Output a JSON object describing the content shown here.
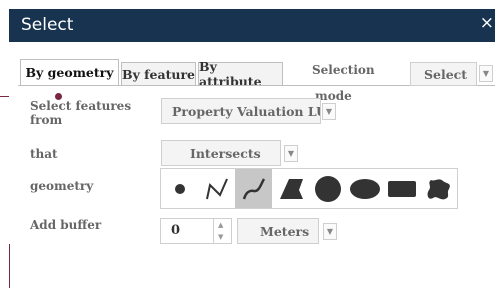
{
  "dialog": {
    "title": "Select",
    "close": "×"
  },
  "tabs": [
    {
      "label": "By geometry",
      "active": true
    },
    {
      "label": "By feature",
      "active": false
    },
    {
      "label": "By attribute",
      "active": false
    }
  ],
  "selection_mode": {
    "label_line1": "Selection",
    "label_line2": "mode",
    "value": "Select"
  },
  "form": {
    "select_from_label": "Select features from",
    "select_from_value": "Property Valuation LU",
    "that_label": "that",
    "that_value": "Intersects",
    "geometry_label": "geometry",
    "geometry_tools": [
      {
        "icon": "point-icon",
        "selected": false
      },
      {
        "icon": "polyline-icon",
        "selected": false
      },
      {
        "icon": "freehand-line-icon",
        "selected": true
      },
      {
        "icon": "polygon-icon",
        "selected": false
      },
      {
        "icon": "circle-icon",
        "selected": false
      },
      {
        "icon": "ellipse-icon",
        "selected": false
      },
      {
        "icon": "rectangle-icon",
        "selected": false
      },
      {
        "icon": "freehand-polygon-icon",
        "selected": false
      }
    ],
    "buffer_label": "Add buffer",
    "buffer_value": "0",
    "buffer_unit": "Meters"
  },
  "colors": {
    "titlebar": "#17334f",
    "callout": "#7a2740",
    "selected_tool": "#c7c7c7",
    "icon_fill": "#333333"
  }
}
